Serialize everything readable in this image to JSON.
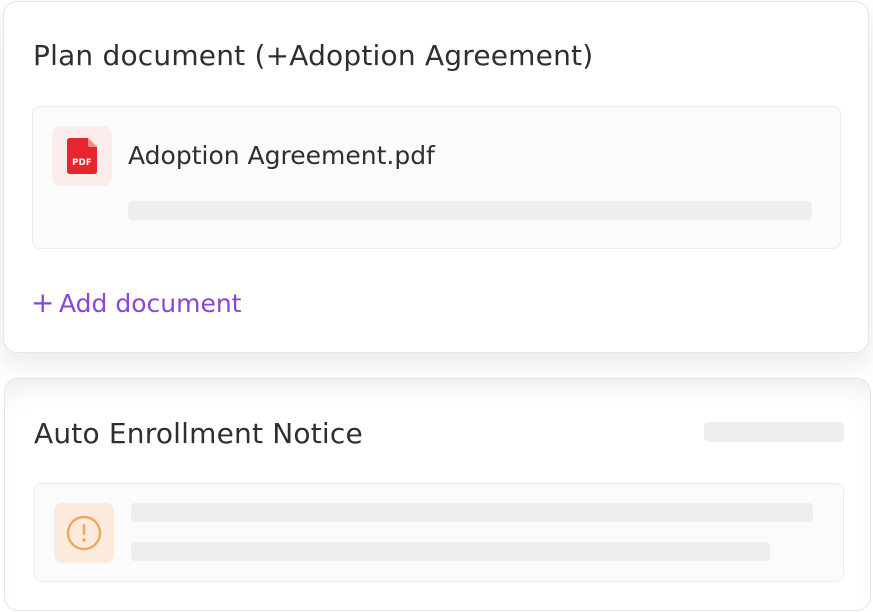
{
  "plan_card": {
    "title": "Plan document (+Adoption Agreement)",
    "file": {
      "name": "Adoption Agreement.pdf",
      "icon": "pdf-file-icon",
      "icon_label": "PDF"
    },
    "add_document": {
      "icon": "plus-icon",
      "label": "Add document"
    }
  },
  "notice_card": {
    "title": "Auto Enrollment Notice",
    "status_icon": "warning-circle-icon"
  },
  "colors": {
    "accent": "#8b45d9",
    "pdf_red": "#e5262c",
    "pdf_tile_bg": "#fdecec",
    "warning_orange": "#f2a55a",
    "warning_tile_bg": "#fcebdd",
    "skeleton": "#eeeeee",
    "text": "#2f2f33"
  }
}
